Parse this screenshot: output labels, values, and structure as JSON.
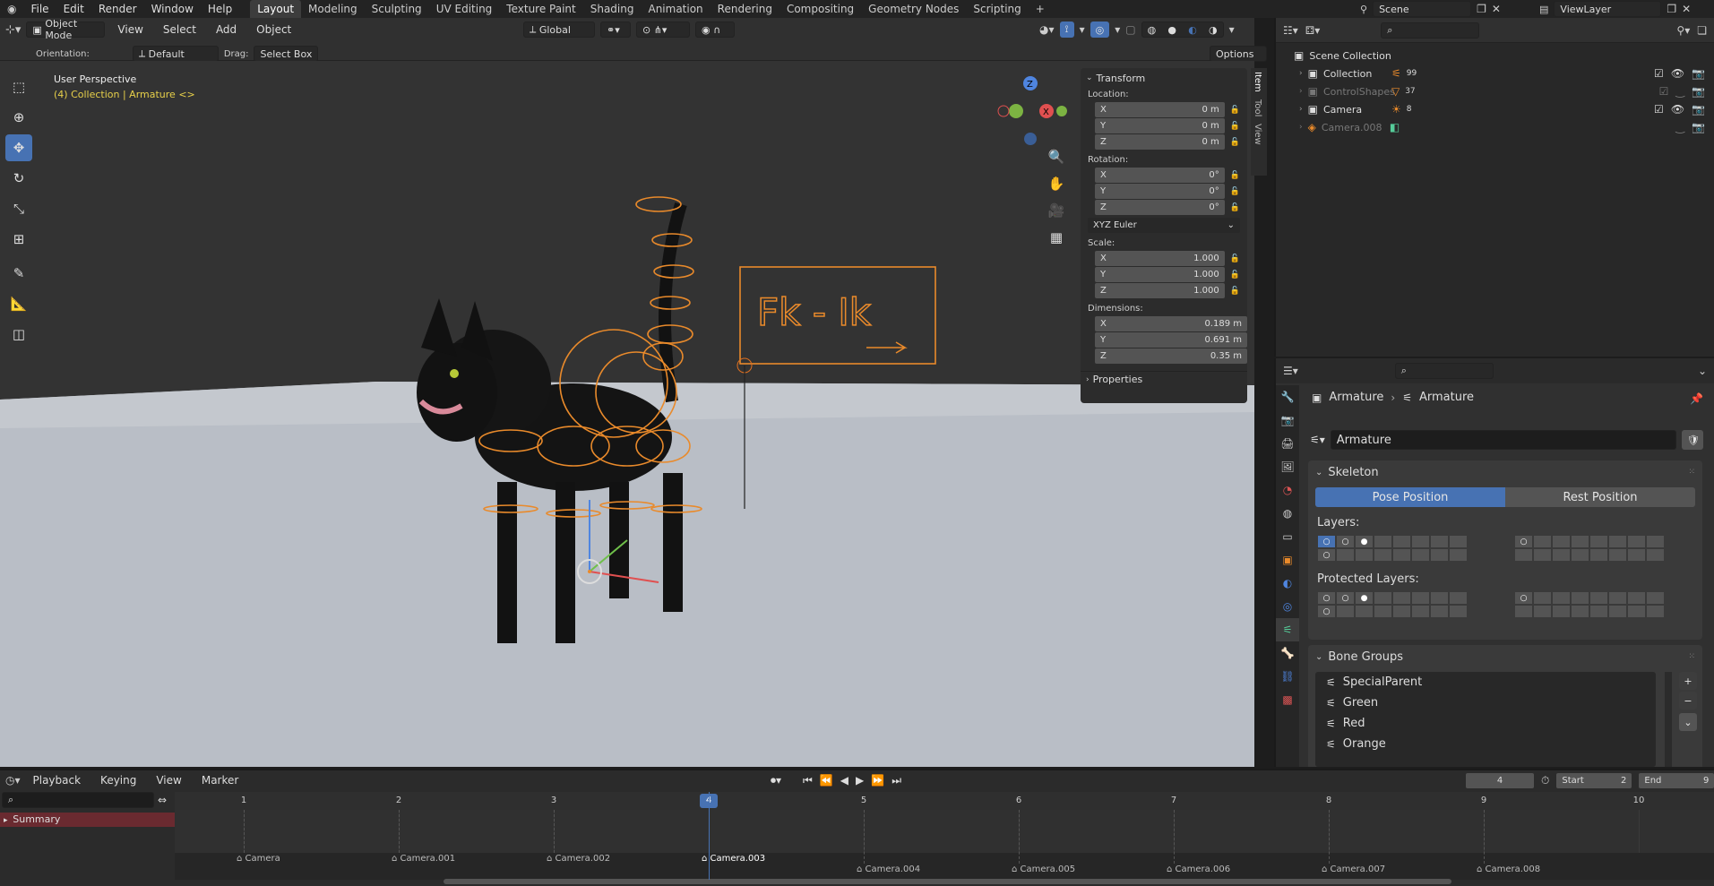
{
  "topmenu": {
    "items": [
      "File",
      "Edit",
      "Render",
      "Window",
      "Help"
    ],
    "workspaces": [
      "Layout",
      "Modeling",
      "Sculpting",
      "UV Editing",
      "Texture Paint",
      "Shading",
      "Animation",
      "Rendering",
      "Compositing",
      "Geometry Nodes",
      "Scripting"
    ],
    "add_ws": "+",
    "scene_label": "Scene",
    "viewlayer_label": "ViewLayer"
  },
  "viewport_header": {
    "mode": "Object Mode",
    "menus": [
      "View",
      "Select",
      "Add",
      "Object"
    ],
    "transform_orientation": "Global",
    "orientation_label": "Orientation:",
    "orientation_value": "Default",
    "drag_label": "Drag:",
    "drag_value": "Select Box",
    "options": "Options"
  },
  "viewport": {
    "perspective": "User Perspective",
    "context": "(4) Collection | Armature <>",
    "sign_text": "Fk  -  Ik"
  },
  "npanel": {
    "tabs": [
      "Item",
      "Tool",
      "View"
    ],
    "transform_title": "Transform",
    "location_label": "Location:",
    "location": [
      {
        "axis": "X",
        "value": "0 m"
      },
      {
        "axis": "Y",
        "value": "0 m"
      },
      {
        "axis": "Z",
        "value": "0 m"
      }
    ],
    "rotation_label": "Rotation:",
    "rotation": [
      {
        "axis": "X",
        "value": "0°"
      },
      {
        "axis": "Y",
        "value": "0°"
      },
      {
        "axis": "Z",
        "value": "0°"
      }
    ],
    "rotation_mode": "XYZ Euler",
    "scale_label": "Scale:",
    "scale": [
      {
        "axis": "X",
        "value": "1.000"
      },
      {
        "axis": "Y",
        "value": "1.000"
      },
      {
        "axis": "Z",
        "value": "1.000"
      }
    ],
    "dimensions_label": "Dimensions:",
    "dimensions": [
      {
        "axis": "X",
        "value": "0.189 m"
      },
      {
        "axis": "Y",
        "value": "0.691 m"
      },
      {
        "axis": "Z",
        "value": "0.35 m"
      }
    ],
    "properties_title": "Properties"
  },
  "outliner": {
    "root": "Scene Collection",
    "items": [
      {
        "name": "Collection",
        "badge": "99",
        "dim": false
      },
      {
        "name": "ControlShapes",
        "badge": "37",
        "dim": true
      },
      {
        "name": "Camera",
        "badge": "8",
        "dim": false
      },
      {
        "name": "Camera.008",
        "badge": "",
        "dim": true
      }
    ]
  },
  "properties": {
    "breadcrumb_a": "Armature",
    "breadcrumb_b": "Armature",
    "name_field": "Armature",
    "skeleton_title": "Skeleton",
    "pose_position": "Pose Position",
    "rest_position": "Rest Position",
    "layers_label": "Layers:",
    "protected_label": "Protected Layers:",
    "bone_groups_title": "Bone Groups",
    "bone_groups": [
      "SpecialParent",
      "Green",
      "Red",
      "Orange"
    ]
  },
  "timeline": {
    "menus": [
      "Playback",
      "Keying",
      "View",
      "Marker"
    ],
    "current_frame": "4",
    "start_label": "Start",
    "start": "2",
    "end_label": "End",
    "end": "9",
    "ticks": [
      "1",
      "2",
      "3",
      "4",
      "5",
      "6",
      "7",
      "8",
      "9",
      "10"
    ],
    "summary": "Summary",
    "markers": [
      "Camera",
      "Camera.001",
      "Camera.002",
      "Camera.003",
      "Camera.004",
      "Camera.005",
      "Camera.006",
      "Camera.007",
      "Camera.008"
    ]
  },
  "colors": {
    "accent": "#4772b3",
    "orange": "#e98a2b",
    "playhead": "#4772b3"
  }
}
